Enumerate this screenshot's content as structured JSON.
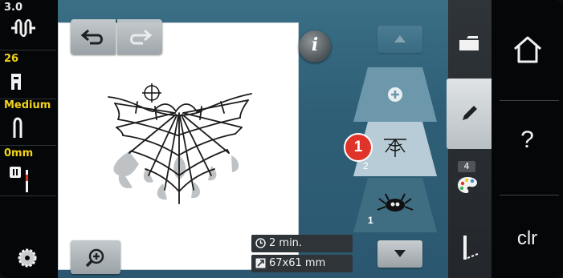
{
  "status_panel": {
    "stitch_length": "3.0",
    "presser_foot_number": "26",
    "thread_tension": "Medium",
    "needle_position": "0mm"
  },
  "info_button_label": "i",
  "layers": {
    "callout_number": "1",
    "layer2_number": "2",
    "layer1_number": "1"
  },
  "stats": {
    "time": "2 min.",
    "size": "67x61 mm"
  },
  "tabs": {
    "color_count": "4"
  },
  "nav": {
    "help_label": "?",
    "clear_label": "clr"
  },
  "icons": [
    "stitch-length-icon",
    "presser-foot-icon",
    "needle-icon",
    "needle-position-icon",
    "bobbin-icon",
    "undo-icon",
    "redo-icon",
    "zoom-in-icon",
    "info-icon",
    "arrow-up-icon",
    "arrow-down-icon",
    "add-icon",
    "spider-web-icon",
    "spider-icon",
    "clock-icon",
    "size-icon",
    "folder-icon",
    "pencil-icon",
    "palette-icon",
    "stitch-path-icon",
    "home-icon"
  ],
  "colors": {
    "accent_red": "#e0342a",
    "status_yellow": "#f2d21c",
    "panel_blue": "#3a6f86"
  }
}
